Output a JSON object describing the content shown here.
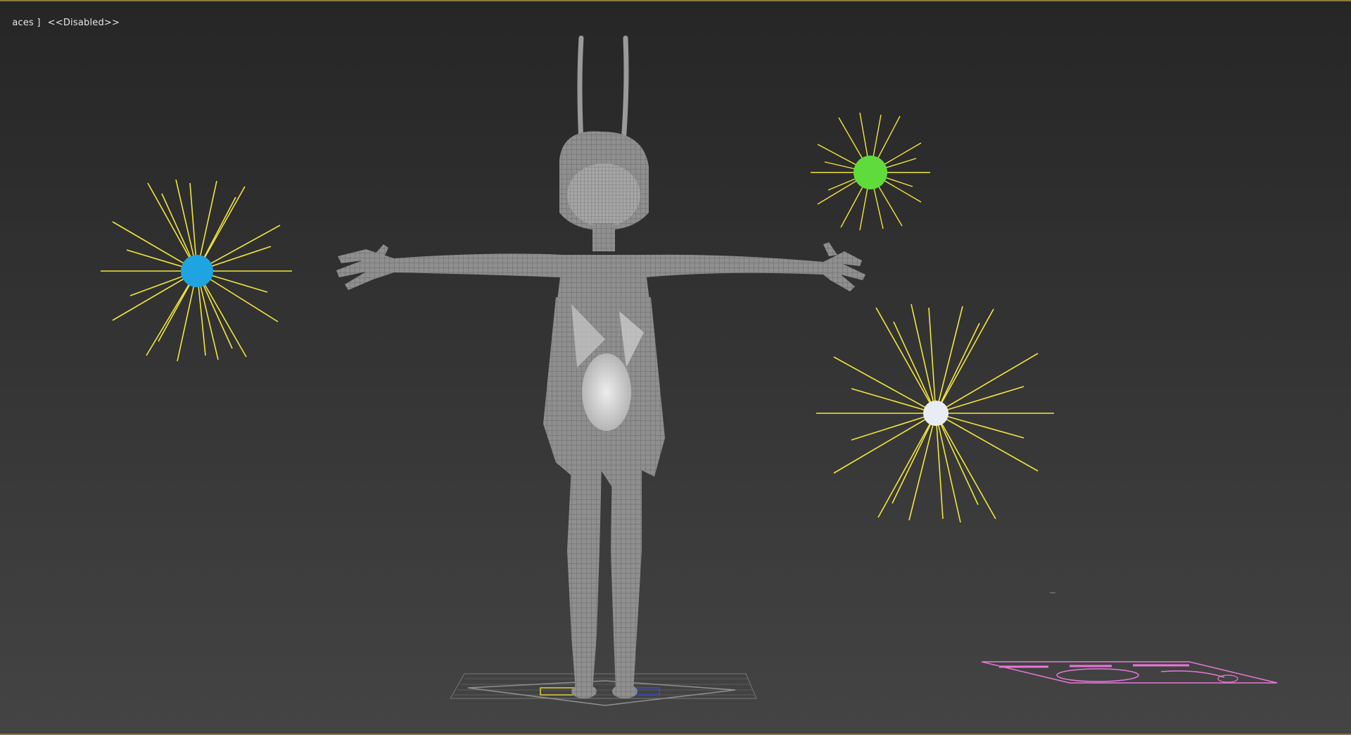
{
  "viewport": {
    "label_shading": "aces ]",
    "label_status": "<<Disabled>>"
  },
  "colors": {
    "ray": "#f2e63a",
    "light_left": "#1ea4e0",
    "light_top_right": "#5fdc3c",
    "light_bottom_right": "#e8ecf5",
    "mesh": "#9a9a9a",
    "mesh_wire": "#6d6d6d",
    "grid": "#7a7a7a",
    "pink_object": "#e878d8"
  },
  "icons": {
    "omni_light": "sun-burst-icon",
    "character": "tpose-figure",
    "ground_grid": "grid-plane",
    "pink_shape": "spline-shape"
  }
}
